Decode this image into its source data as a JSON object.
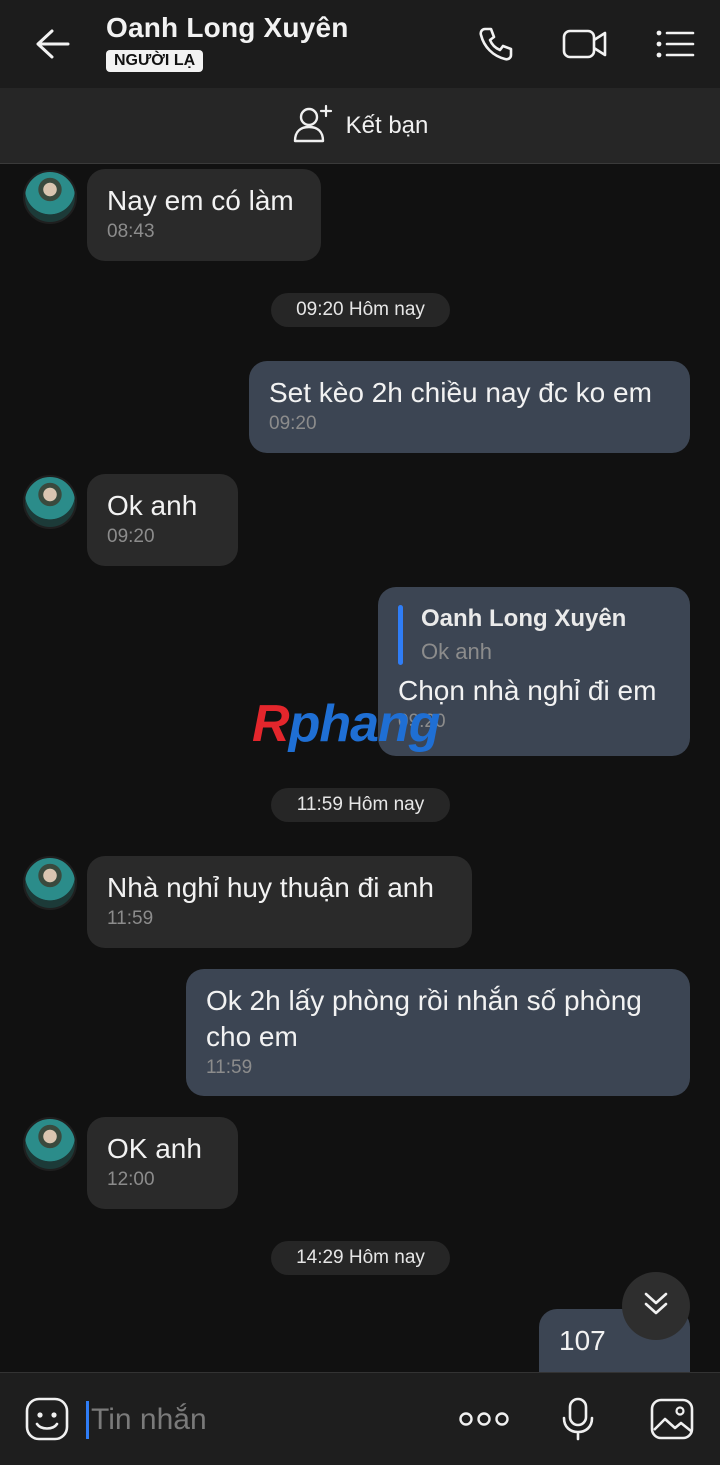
{
  "header": {
    "title": "Oanh Long Xuyên",
    "badge": "NGƯỜI LẠ",
    "icons": [
      "back-arrow-icon",
      "phone-icon",
      "video-camera-icon",
      "menu-list-icon"
    ]
  },
  "add_friend": {
    "label": "Kết bạn",
    "icon": "add-friend-icon"
  },
  "messages": [
    {
      "direction": "in",
      "text": "Nay em có làm",
      "time": "08:43"
    },
    {
      "type": "date",
      "text": "09:20 Hôm nay"
    },
    {
      "direction": "out",
      "text": "Set kèo 2h chiều nay đc ko em",
      "time": "09:20"
    },
    {
      "direction": "in",
      "text": "Ok anh",
      "time": "09:20"
    },
    {
      "direction": "out",
      "quote_name": "Oanh Long Xuyên",
      "quote_text": "Ok anh",
      "text": "Chọn nhà nghỉ đi em",
      "time": "09:20"
    },
    {
      "type": "date",
      "text": "11:59 Hôm nay"
    },
    {
      "direction": "in",
      "text": "Nhà nghỉ huy thuận đi anh",
      "time": "11:59"
    },
    {
      "direction": "out",
      "text": "Ok 2h lấy phòng rồi nhắn số phòng cho em",
      "time": "11:59"
    },
    {
      "direction": "in",
      "text": "OK anh",
      "time": "12:00"
    },
    {
      "type": "date",
      "text": "14:29 Hôm nay"
    },
    {
      "direction": "out",
      "text": "107"
    }
  ],
  "watermark": {
    "first": "R",
    "rest": "phang"
  },
  "input": {
    "placeholder": "Tin nhắn"
  },
  "colors": {
    "accent": "#2f7df6",
    "bubble_in": "#2a2a2a",
    "bubble_out": "#3c4553",
    "background": "#111111"
  }
}
